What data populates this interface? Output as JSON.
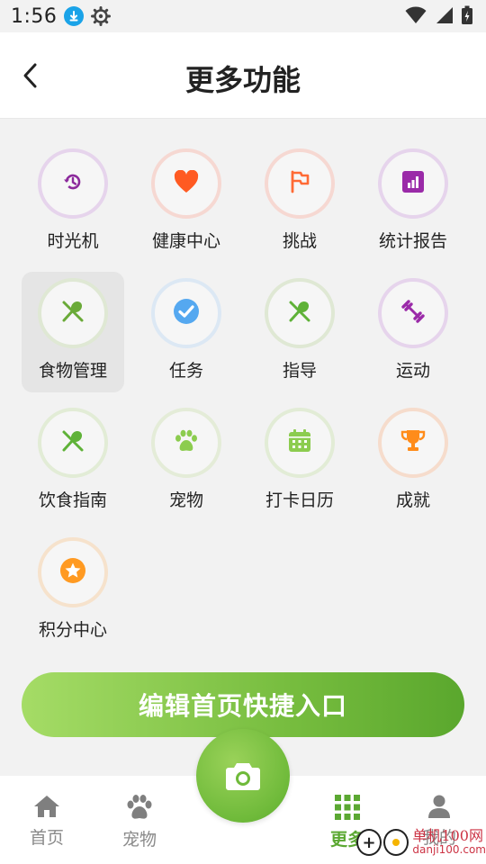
{
  "status_bar": {
    "time": "1:56"
  },
  "header": {
    "title": "更多功能"
  },
  "features": [
    {
      "label": "时光机",
      "icon": "history-icon",
      "ring": "#e6d4ec",
      "color": "#8c2a9c"
    },
    {
      "label": "健康中心",
      "icon": "heart-icon",
      "ring": "#f6d8d2",
      "color": "#ff5a22"
    },
    {
      "label": "挑战",
      "icon": "flag-icon",
      "ring": "#f6d8d2",
      "color": "#ff6a35"
    },
    {
      "label": "统计报告",
      "icon": "chart-icon",
      "ring": "#e6d4ec",
      "color": "#9a2aa8"
    },
    {
      "label": "食物管理",
      "icon": "utensils-icon",
      "ring": "#dfe8d4",
      "color": "#6aaa38",
      "active": true
    },
    {
      "label": "任务",
      "icon": "check-circle-icon",
      "ring": "#dce8f4",
      "color": "#55a8f0"
    },
    {
      "label": "指导",
      "icon": "utensils-icon",
      "ring": "#dfe8d4",
      "color": "#5fb238"
    },
    {
      "label": "运动",
      "icon": "dumbbell-icon",
      "ring": "#e6d4ec",
      "color": "#9a2aa8"
    },
    {
      "label": "饮食指南",
      "icon": "utensils-icon",
      "ring": "#e2ecd6",
      "color": "#5fb238"
    },
    {
      "label": "宠物",
      "icon": "paw-icon",
      "ring": "#e4ecd8",
      "color": "#8ccc4f"
    },
    {
      "label": "打卡日历",
      "icon": "calendar-icon",
      "ring": "#e2ecd6",
      "color": "#8ccc4f"
    },
    {
      "label": "成就",
      "icon": "trophy-icon",
      "ring": "#f6dccc",
      "color": "#ff8c1a"
    },
    {
      "label": "积分中心",
      "icon": "star-icon",
      "ring": "#f6e2cc",
      "color": "#ff9a22"
    }
  ],
  "edit_button": {
    "label": "编辑首页快捷入口"
  },
  "tabbar": {
    "home": "首页",
    "pets": "宠物",
    "more": "更多",
    "profile": "我的"
  },
  "watermark": {
    "badge": "+",
    "title": "单机100网",
    "url": "danji100.com"
  }
}
